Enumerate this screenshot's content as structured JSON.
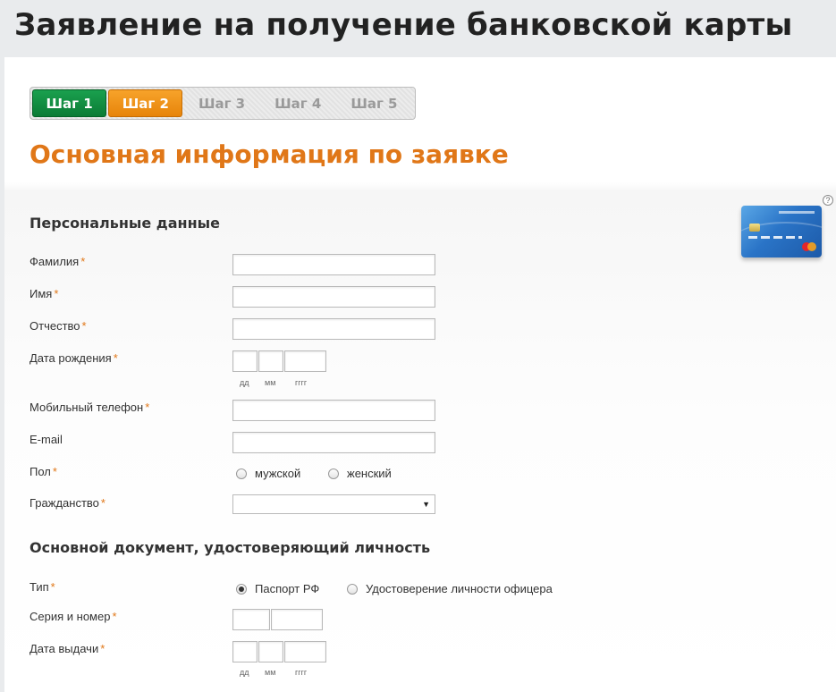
{
  "page_title": "Заявление на получение банковской карты",
  "steps": [
    "Шаг 1",
    "Шаг 2",
    "Шаг 3",
    "Шаг 4",
    "Шаг 5"
  ],
  "active_step": 2,
  "section_title": "Основная информация по заявке",
  "help_symbol": "?",
  "required_marker": "*",
  "personal": {
    "title": "Персональные данные",
    "last_name_label": "Фамилия",
    "first_name_label": "Имя",
    "patronymic_label": "Отчество",
    "birth_date_label": "Дата рождения",
    "mobile_label": "Мобильный телефон",
    "email_label": "E-mail",
    "gender_label": "Пол",
    "gender_male": "мужской",
    "gender_female": "женский",
    "citizenship_label": "Гражданство",
    "date_hints": [
      "дд",
      "мм",
      "гггг"
    ]
  },
  "document": {
    "title": "Основной документ, удостоверяющий личность",
    "type_label": "Тип",
    "type_passport": "Паспорт РФ",
    "type_officer": "Удостоверение личности офицера",
    "series_label": "Серия и номер",
    "issue_date_label": "Дата выдачи",
    "date_hints": [
      "дд",
      "мм",
      "гггг"
    ]
  },
  "colors": {
    "accent_orange": "#e07718",
    "step_done_green": "#0b7c36",
    "step_active_orange": "#e7840a"
  },
  "icons": {
    "help": "help-icon",
    "card": "bank-card-image",
    "select_arrow": "chevron-down-icon"
  }
}
